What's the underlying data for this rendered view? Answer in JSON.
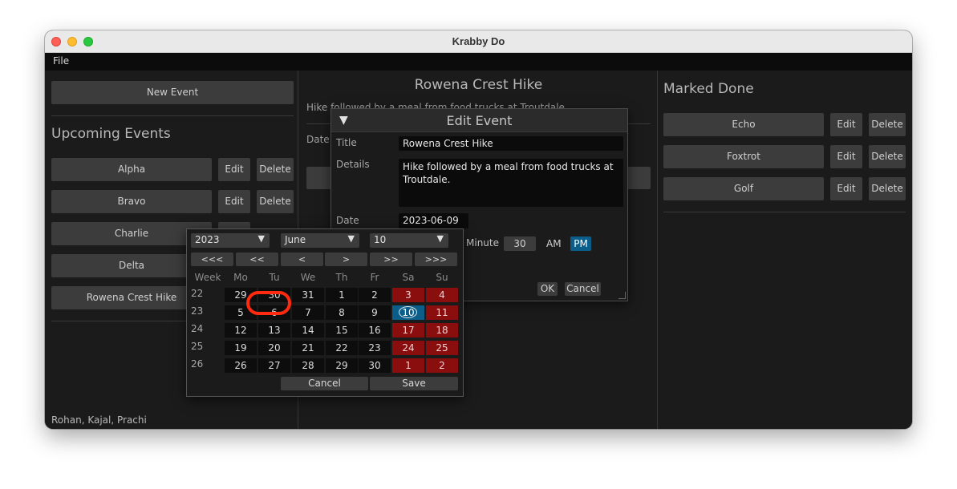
{
  "window": {
    "title": "Krabby Do"
  },
  "menu": {
    "file": "File"
  },
  "left": {
    "new_event": "New Event",
    "heading": "Upcoming Events",
    "events": [
      {
        "name": "Alpha",
        "edit": "Edit",
        "delete": "Delete"
      },
      {
        "name": "Bravo",
        "edit": "Edit",
        "delete": "Delete"
      },
      {
        "name": "Charlie"
      },
      {
        "name": "Delta"
      },
      {
        "name": "Rowena Crest Hike"
      }
    ],
    "credits": "Rohan, Kajal, Prachi"
  },
  "center": {
    "title": "Rowena Crest Hike",
    "details": "Hike followed by a meal from food trucks at Troutdale.",
    "date_label": "Date:"
  },
  "right": {
    "heading": "Marked Done",
    "events": [
      {
        "name": "Echo",
        "edit": "Edit",
        "delete": "Delete"
      },
      {
        "name": "Foxtrot",
        "edit": "Edit",
        "delete": "Delete"
      },
      {
        "name": "Golf",
        "edit": "Edit",
        "delete": "Delete"
      }
    ]
  },
  "dialog": {
    "title": "Edit Event",
    "title_label": "Title",
    "title_value": "Rowena Crest Hike",
    "details_label": "Details",
    "details_value": "Hike followed by a meal from food trucks at Troutdale.",
    "date_label": "Date",
    "date_value": "2023-06-09",
    "calendar_icon": "calendar-icon",
    "minute_label": "Minute",
    "minute_value": "30",
    "am": "AM",
    "pm": "PM",
    "ok": "OK",
    "cancel": "Cancel"
  },
  "calendar": {
    "year": "2023",
    "month": "June",
    "day": "10",
    "nav": [
      "<<<",
      "<<",
      "<",
      ">",
      ">>",
      ">>>"
    ],
    "headers": [
      "Week",
      "Mo",
      "Tu",
      "We",
      "Th",
      "Fr",
      "Sa",
      "Su"
    ],
    "weeks": [
      {
        "week": "22",
        "days": [
          "29",
          "30",
          "31",
          "1",
          "2",
          "3",
          "4"
        ]
      },
      {
        "week": "23",
        "days": [
          "5",
          "6",
          "7",
          "8",
          "9",
          "10",
          "11"
        ]
      },
      {
        "week": "24",
        "days": [
          "12",
          "13",
          "14",
          "15",
          "16",
          "17",
          "18"
        ]
      },
      {
        "week": "25",
        "days": [
          "19",
          "20",
          "21",
          "22",
          "23",
          "24",
          "25"
        ]
      },
      {
        "week": "26",
        "days": [
          "26",
          "27",
          "28",
          "29",
          "30",
          "1",
          "2"
        ]
      }
    ],
    "selected": "10",
    "cancel": "Cancel",
    "save": "Save",
    "colors": {
      "weekend": "#8b0e0e",
      "selected": "#0b5e8a",
      "highlight": "#ff2a10"
    }
  }
}
